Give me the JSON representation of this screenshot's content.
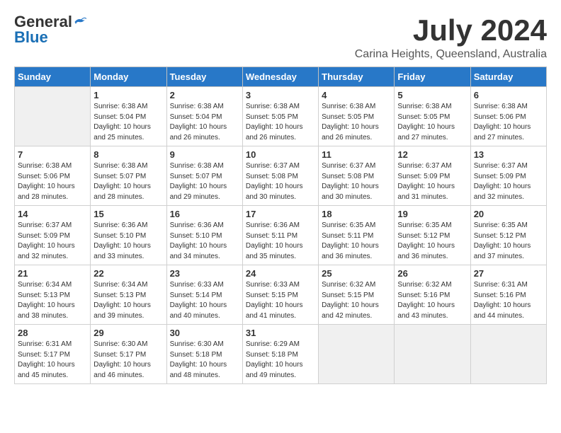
{
  "header": {
    "logo_general": "General",
    "logo_blue": "Blue",
    "month_year": "July 2024",
    "location": "Carina Heights, Queensland, Australia"
  },
  "weekdays": [
    "Sunday",
    "Monday",
    "Tuesday",
    "Wednesday",
    "Thursday",
    "Friday",
    "Saturday"
  ],
  "weeks": [
    [
      {
        "day": "",
        "info": ""
      },
      {
        "day": "1",
        "info": "Sunrise: 6:38 AM\nSunset: 5:04 PM\nDaylight: 10 hours\nand 25 minutes."
      },
      {
        "day": "2",
        "info": "Sunrise: 6:38 AM\nSunset: 5:04 PM\nDaylight: 10 hours\nand 26 minutes."
      },
      {
        "day": "3",
        "info": "Sunrise: 6:38 AM\nSunset: 5:05 PM\nDaylight: 10 hours\nand 26 minutes."
      },
      {
        "day": "4",
        "info": "Sunrise: 6:38 AM\nSunset: 5:05 PM\nDaylight: 10 hours\nand 26 minutes."
      },
      {
        "day": "5",
        "info": "Sunrise: 6:38 AM\nSunset: 5:05 PM\nDaylight: 10 hours\nand 27 minutes."
      },
      {
        "day": "6",
        "info": "Sunrise: 6:38 AM\nSunset: 5:06 PM\nDaylight: 10 hours\nand 27 minutes."
      }
    ],
    [
      {
        "day": "7",
        "info": "Sunrise: 6:38 AM\nSunset: 5:06 PM\nDaylight: 10 hours\nand 28 minutes."
      },
      {
        "day": "8",
        "info": "Sunrise: 6:38 AM\nSunset: 5:07 PM\nDaylight: 10 hours\nand 28 minutes."
      },
      {
        "day": "9",
        "info": "Sunrise: 6:38 AM\nSunset: 5:07 PM\nDaylight: 10 hours\nand 29 minutes."
      },
      {
        "day": "10",
        "info": "Sunrise: 6:37 AM\nSunset: 5:08 PM\nDaylight: 10 hours\nand 30 minutes."
      },
      {
        "day": "11",
        "info": "Sunrise: 6:37 AM\nSunset: 5:08 PM\nDaylight: 10 hours\nand 30 minutes."
      },
      {
        "day": "12",
        "info": "Sunrise: 6:37 AM\nSunset: 5:09 PM\nDaylight: 10 hours\nand 31 minutes."
      },
      {
        "day": "13",
        "info": "Sunrise: 6:37 AM\nSunset: 5:09 PM\nDaylight: 10 hours\nand 32 minutes."
      }
    ],
    [
      {
        "day": "14",
        "info": "Sunrise: 6:37 AM\nSunset: 5:09 PM\nDaylight: 10 hours\nand 32 minutes."
      },
      {
        "day": "15",
        "info": "Sunrise: 6:36 AM\nSunset: 5:10 PM\nDaylight: 10 hours\nand 33 minutes."
      },
      {
        "day": "16",
        "info": "Sunrise: 6:36 AM\nSunset: 5:10 PM\nDaylight: 10 hours\nand 34 minutes."
      },
      {
        "day": "17",
        "info": "Sunrise: 6:36 AM\nSunset: 5:11 PM\nDaylight: 10 hours\nand 35 minutes."
      },
      {
        "day": "18",
        "info": "Sunrise: 6:35 AM\nSunset: 5:11 PM\nDaylight: 10 hours\nand 36 minutes."
      },
      {
        "day": "19",
        "info": "Sunrise: 6:35 AM\nSunset: 5:12 PM\nDaylight: 10 hours\nand 36 minutes."
      },
      {
        "day": "20",
        "info": "Sunrise: 6:35 AM\nSunset: 5:12 PM\nDaylight: 10 hours\nand 37 minutes."
      }
    ],
    [
      {
        "day": "21",
        "info": "Sunrise: 6:34 AM\nSunset: 5:13 PM\nDaylight: 10 hours\nand 38 minutes."
      },
      {
        "day": "22",
        "info": "Sunrise: 6:34 AM\nSunset: 5:13 PM\nDaylight: 10 hours\nand 39 minutes."
      },
      {
        "day": "23",
        "info": "Sunrise: 6:33 AM\nSunset: 5:14 PM\nDaylight: 10 hours\nand 40 minutes."
      },
      {
        "day": "24",
        "info": "Sunrise: 6:33 AM\nSunset: 5:15 PM\nDaylight: 10 hours\nand 41 minutes."
      },
      {
        "day": "25",
        "info": "Sunrise: 6:32 AM\nSunset: 5:15 PM\nDaylight: 10 hours\nand 42 minutes."
      },
      {
        "day": "26",
        "info": "Sunrise: 6:32 AM\nSunset: 5:16 PM\nDaylight: 10 hours\nand 43 minutes."
      },
      {
        "day": "27",
        "info": "Sunrise: 6:31 AM\nSunset: 5:16 PM\nDaylight: 10 hours\nand 44 minutes."
      }
    ],
    [
      {
        "day": "28",
        "info": "Sunrise: 6:31 AM\nSunset: 5:17 PM\nDaylight: 10 hours\nand 45 minutes."
      },
      {
        "day": "29",
        "info": "Sunrise: 6:30 AM\nSunset: 5:17 PM\nDaylight: 10 hours\nand 46 minutes."
      },
      {
        "day": "30",
        "info": "Sunrise: 6:30 AM\nSunset: 5:18 PM\nDaylight: 10 hours\nand 48 minutes."
      },
      {
        "day": "31",
        "info": "Sunrise: 6:29 AM\nSunset: 5:18 PM\nDaylight: 10 hours\nand 49 minutes."
      },
      {
        "day": "",
        "info": ""
      },
      {
        "day": "",
        "info": ""
      },
      {
        "day": "",
        "info": ""
      }
    ]
  ]
}
